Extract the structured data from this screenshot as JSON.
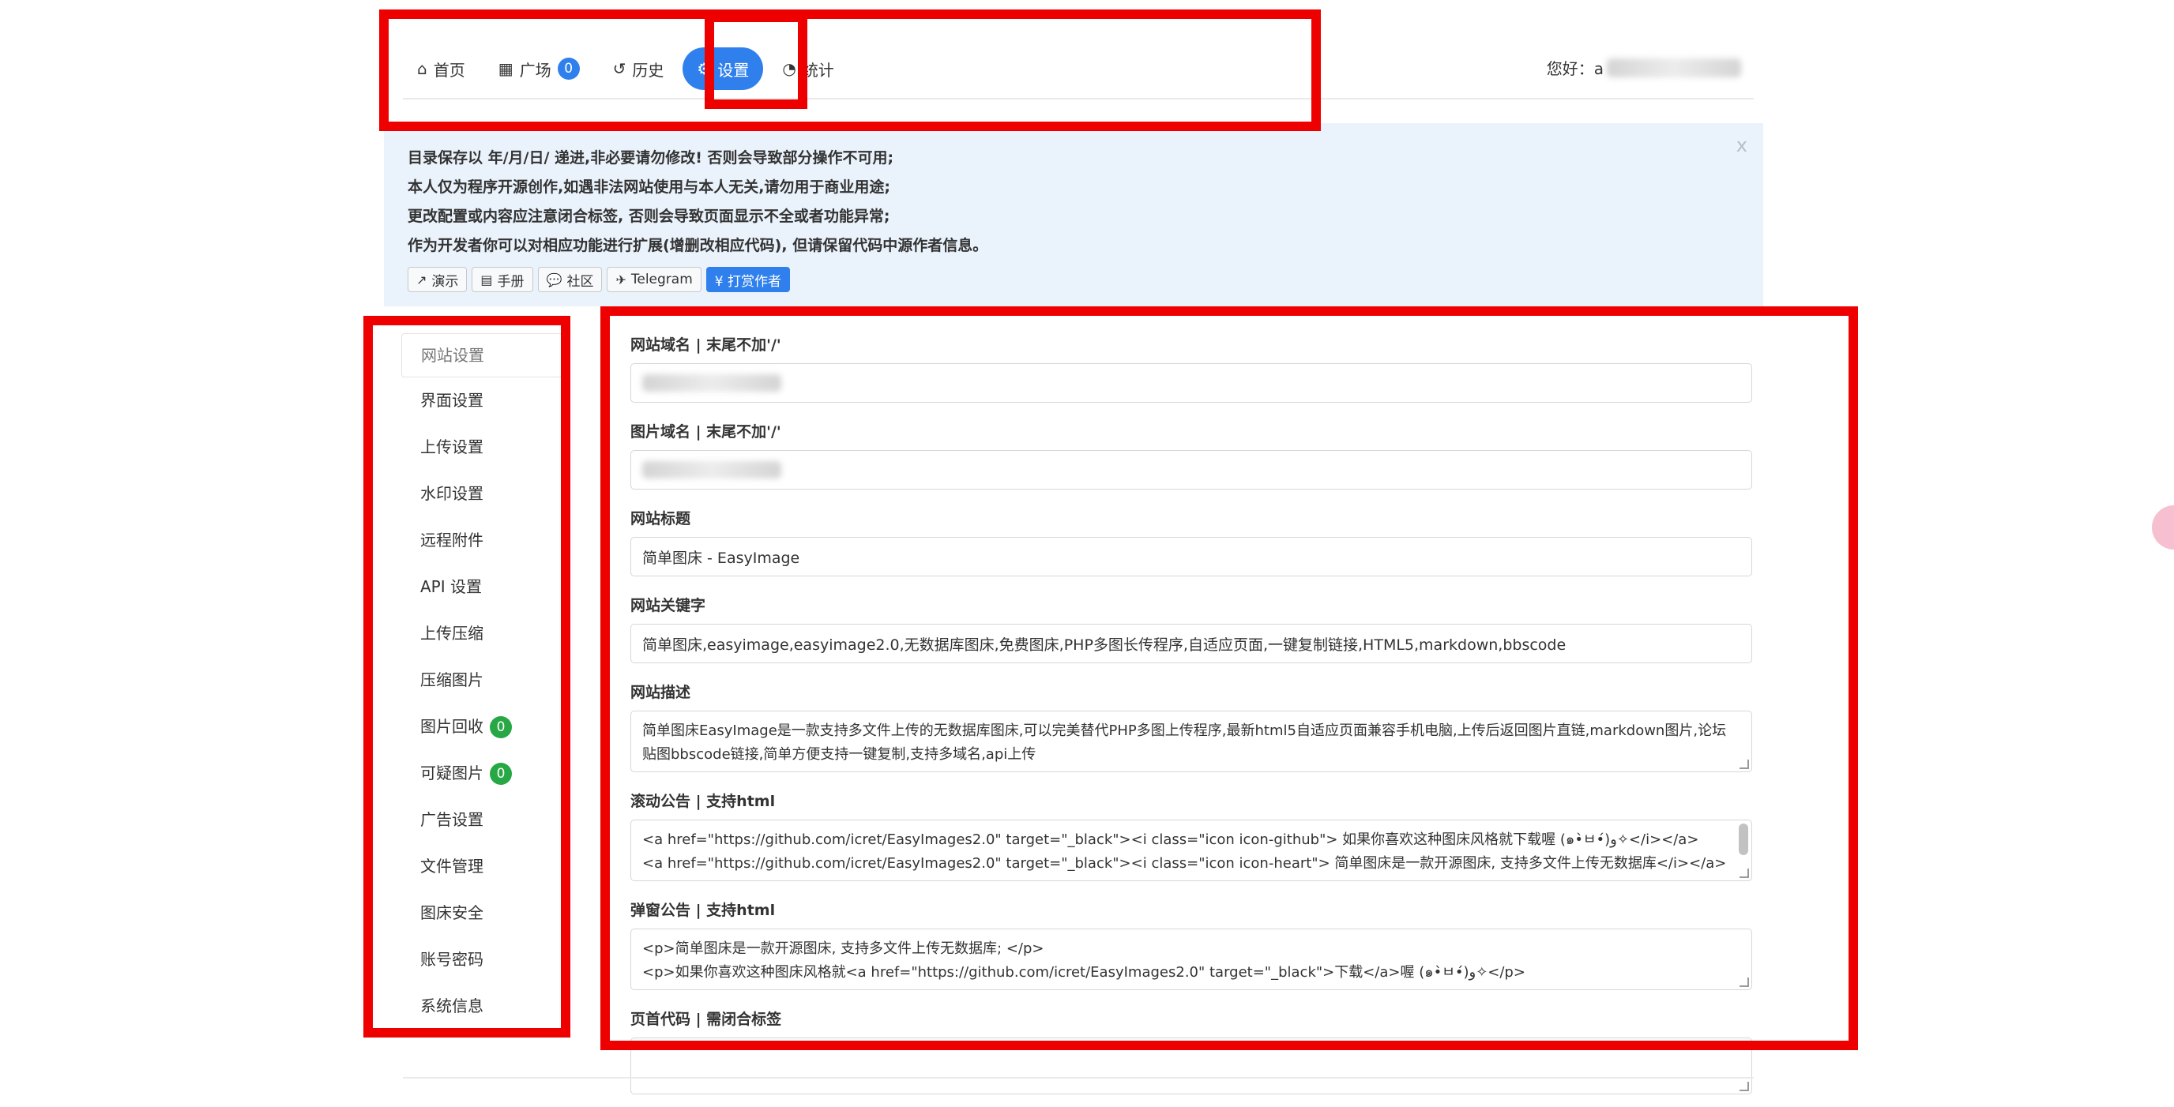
{
  "nav": {
    "items": [
      {
        "label": "首页",
        "icon": "home-icon",
        "glyph": "⌂"
      },
      {
        "label": "广场",
        "icon": "grid-icon",
        "glyph": "▦",
        "badge": "0"
      },
      {
        "label": "历史",
        "icon": "history-icon",
        "glyph": "↺"
      },
      {
        "label": "设置",
        "icon": "gears-icon",
        "glyph": "⚙",
        "active": true
      },
      {
        "label": "统计",
        "icon": "pie-chart-icon",
        "glyph": "◔"
      }
    ],
    "greeting": "您好：a"
  },
  "notice": {
    "lines": [
      "目录保存以 年/月/日/ 递进,非必要请勿修改! 否则会导致部分操作不可用;",
      "本人仅为程序开源创作,如遇非法网站使用与本人无关,请勿用于商业用途;",
      "更改配置或内容应注意闭合标签, 否则会导致页面显示不全或者功能异常;",
      "作为开发者你可以对相应功能进行扩展(增删改相应代码), 但请保留代码中源作者信息。"
    ],
    "close": "x",
    "buttons": [
      {
        "label": "演示",
        "icon": "external-link-icon",
        "glyph": "↗"
      },
      {
        "label": "手册",
        "icon": "book-icon",
        "glyph": "▤"
      },
      {
        "label": "社区",
        "icon": "comments-icon",
        "glyph": "💬"
      },
      {
        "label": "Telegram",
        "icon": "paper-plane-icon",
        "glyph": "✈"
      },
      {
        "label": "¥ 打赏作者",
        "primary": true
      }
    ]
  },
  "sidebar": {
    "items": [
      {
        "label": "网站设置",
        "active": true
      },
      {
        "label": "界面设置"
      },
      {
        "label": "上传设置"
      },
      {
        "label": "水印设置"
      },
      {
        "label": "远程附件"
      },
      {
        "label": "API 设置"
      },
      {
        "label": "上传压缩"
      },
      {
        "label": "压缩图片"
      },
      {
        "label": "图片回收",
        "badge": "0"
      },
      {
        "label": "可疑图片",
        "badge": "0"
      },
      {
        "label": "广告设置"
      },
      {
        "label": "文件管理"
      },
      {
        "label": "图床安全"
      },
      {
        "label": "账号密码"
      },
      {
        "label": "系统信息"
      }
    ]
  },
  "form": {
    "site_domain_label": "网站域名 | 末尾不加'/'",
    "image_domain_label": "图片域名 | 末尾不加'/'",
    "site_title_label": "网站标题",
    "site_title_value": "简单图床 - EasyImage",
    "keywords_label": "网站关键字",
    "keywords_value": "简单图床,easyimage,easyimage2.0,无数据库图床,免费图床,PHP多图长传程序,自适应页面,一键复制链接,HTML5,markdown,bbscode",
    "description_label": "网站描述",
    "description_value": "简单图床EasyImage是一款支持多文件上传的无数据库图床,可以完美替代PHP多图上传程序,最新html5自适应页面兼容手机电脑,上传后返回图片直链,markdown图片,论坛贴图bbscode链接,简单方便支持一键复制,支持多域名,api上传",
    "scroll_notice_label": "滚动公告 | 支持html",
    "scroll_notice_line1": "<a href=\"https://github.com/icret/EasyImages2.0\" target=\"_black\"><i class=\"icon icon-github\"> 如果你喜欢这种图床风格就下载喔 (๑•̀ㅂ•́)و✧</i></a>",
    "scroll_notice_line2": "<a href=\"https://github.com/icret/EasyImages2.0\" target=\"_black\"><i class=\"icon icon-heart\"> 简单图床是一款开源图床, 支持多文件上传无数据库</i></a>",
    "popup_notice_label": "弹窗公告 | 支持html",
    "popup_notice_line1": "<p>简单图床是一款开源图床, 支持多文件上传无数据库;  </p>",
    "popup_notice_line2": "<p>如果你喜欢这种图床风格就<a href=\"https://github.com/icret/EasyImages2.0\" target=\"_black\">下载</a>喔 (๑•̀ㅂ•́)و✧</p>",
    "header_code_label": "页首代码 | 需闭合标签"
  },
  "colors": {
    "accent": "#2f80ed",
    "badge_green": "#28a745",
    "notice_bg": "#eaf2fb",
    "annotation_red": "#ee0000"
  }
}
